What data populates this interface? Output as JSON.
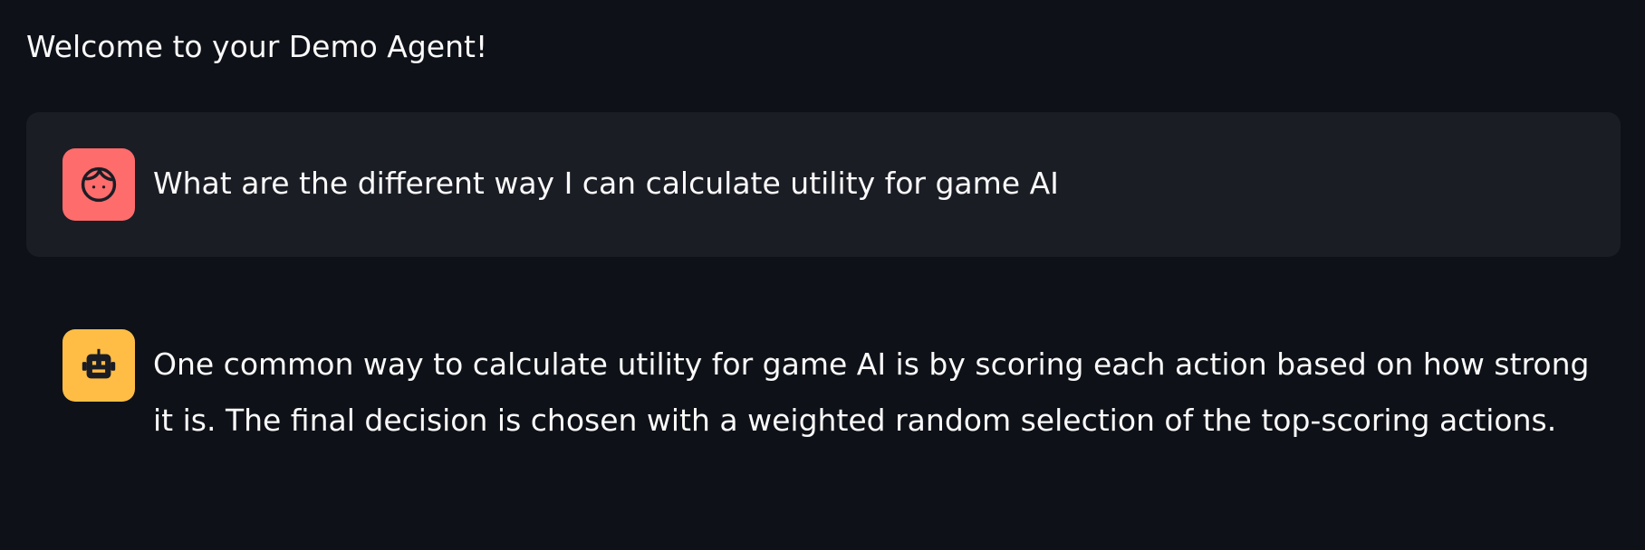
{
  "app": {
    "welcome_text": "Welcome to your Demo Agent!"
  },
  "messages": [
    {
      "role": "user",
      "avatar_icon": "user-face-icon",
      "text": "What are the different way I can calculate utility for game AI"
    },
    {
      "role": "assistant",
      "avatar_icon": "robot-icon",
      "text": "One common way to calculate utility for game AI is by scoring each action based on how strong it is. The final decision is chosen with a weighted random selection of the top-scoring actions."
    }
  ],
  "colors": {
    "background": "#0e1117",
    "user_bubble": "#1b1d25",
    "user_avatar": "#ff6c6c",
    "assistant_avatar": "#ffbd45",
    "text": "#fafafa"
  }
}
